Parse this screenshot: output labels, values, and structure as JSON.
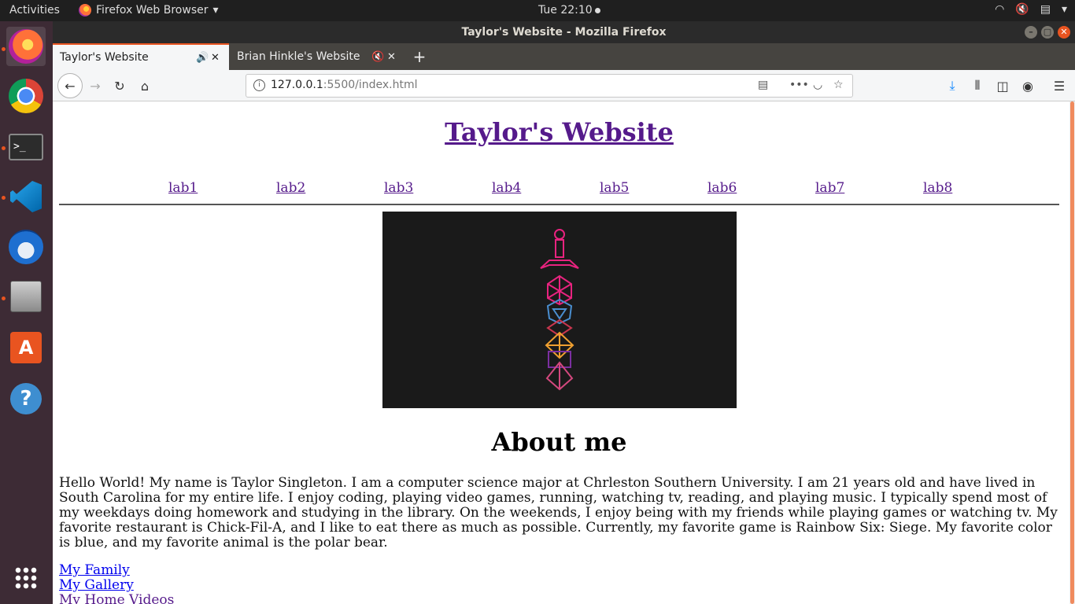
{
  "system_bar": {
    "activities": "Activities",
    "app_menu": "Firefox Web Browser",
    "clock": "Tue 22:10"
  },
  "dock": {
    "items": [
      "firefox-icon",
      "chrome-icon",
      "terminal-icon",
      "vscode-icon",
      "thunderbird-icon",
      "files-icon",
      "software-center-icon",
      "help-icon",
      "app-grid-icon"
    ]
  },
  "window": {
    "title": "Taylor's Website - Mozilla Firefox"
  },
  "tabs": [
    {
      "label": "Taylor's Website",
      "active": true
    },
    {
      "label": "Brian Hinkle's Website",
      "active": false
    }
  ],
  "urlbar": {
    "host": "127.0.0.1",
    "path": ":5500/index.html"
  },
  "page": {
    "title": "Taylor's Website",
    "nav": [
      "lab1",
      "lab2",
      "lab3",
      "lab4",
      "lab5",
      "lab6",
      "lab7",
      "lab8"
    ],
    "about_heading": "About me",
    "bio": "Hello World! My name is Taylor Singleton. I am a computer science major at Chrleston Southern University. I am 21 years old and have lived in South Carolina for my entire life. I enjoy coding, playing video games, running, watching tv, reading, and playing music. I typically spend most of my weekdays doing homework and studying in the library. On the weekends, I enjoy being with my friends while playing games or watching tv. My favorite restaurant is Chick-Fil-A, and I like to eat there as much as possible. Currently, my favorite game is Rainbow Six: Siege. My favorite color is blue, and my favorite animal is the polar bear.",
    "links": [
      "My Family",
      "My Gallery",
      "My Home Videos"
    ]
  },
  "colors": {
    "accent": "#e95420",
    "visited_link": "#551a8b",
    "link": "#0000ee",
    "banner_bg": "#1a1a1a"
  }
}
